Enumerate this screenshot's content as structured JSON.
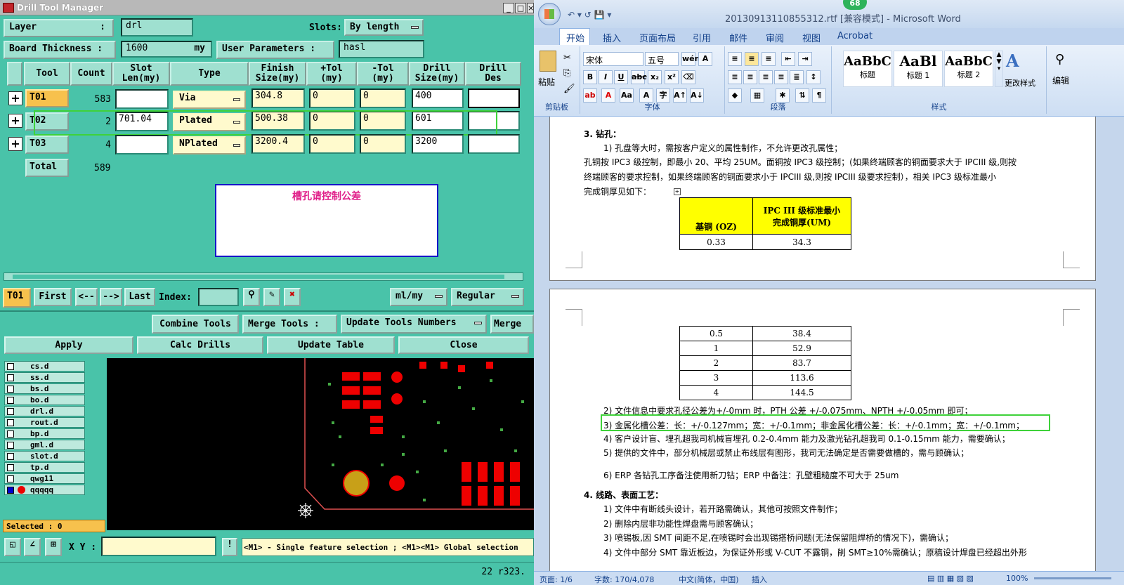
{
  "drill_tool_manager": {
    "title": "Drill Tool Manager",
    "window_buttons": [
      "_",
      "□",
      "×"
    ],
    "layer_label": "Layer",
    "layer_colon": ":",
    "layer_value": "drl",
    "slots_label": "Slots:",
    "slots_value": "By length",
    "board_thickness_label": "Board Thickness :",
    "board_thickness_value": "1600",
    "board_thickness_unit": "my",
    "user_params_label": "User Parameters :",
    "user_params_value": "hasl",
    "columns": [
      "Tool",
      "Count",
      "Slot\nLen(my)",
      "Type",
      "Finish\nSize(my)",
      "+Tol\n(my)",
      "-Tol\n(my)",
      "Drill\nSize(my)",
      "Drill\nDes"
    ],
    "rows": [
      {
        "tool": "T01",
        "count": "583",
        "slot_len": "",
        "type": "Via",
        "finish": "304.8",
        "ptol": "0",
        "ntol": "0",
        "drill": "400",
        "des": ""
      },
      {
        "tool": "T02",
        "count": "2",
        "slot_len": "701.04",
        "type": "Plated",
        "finish": "500.38",
        "ptol": "0",
        "ntol": "0",
        "drill": "601",
        "des": ""
      },
      {
        "tool": "T03",
        "count": "4",
        "slot_len": "",
        "type": "NPlated",
        "finish": "3200.4",
        "ptol": "0",
        "ntol": "0",
        "drill": "3200",
        "des": ""
      }
    ],
    "total_label": "Total",
    "total_count": "589",
    "note": "槽孔请控制公差",
    "nav": {
      "current": "T01",
      "first": "First",
      "prev": "<--",
      "next": "-->",
      "last": "Last",
      "index_label": "Index:",
      "units": "ml/my",
      "mode": "Regular"
    },
    "tool_buttons": [
      "Combine Tools",
      "Merge Tools :",
      "Update Tools Numbers",
      "Merge"
    ],
    "action_buttons": [
      "Apply",
      "Calc Drills",
      "Update Table",
      "Close"
    ],
    "layers": [
      "cs.d",
      "ss.d",
      "bs.d",
      "bo.d",
      "drl.d",
      "rout.d",
      "bp.d",
      "gml.d",
      "slot.d",
      "tp.d",
      "qwg11",
      "qqqqq"
    ],
    "selected": "Selected : 0",
    "xy_label": "X Y :",
    "hint": "<M1> - Single feature selection ; <M1><M1> Global selection",
    "corner": "22 r323."
  },
  "word": {
    "title": "20130913110855312.rtf [兼容模式] - Microsoft Word",
    "badge": "68",
    "tabs": [
      "开始",
      "插入",
      "页面布局",
      "引用",
      "邮件",
      "审阅",
      "视图",
      "Acrobat"
    ],
    "clipboard": {
      "paste": "粘贴",
      "group": "剪贴板"
    },
    "font": {
      "name": "宋体",
      "size": "五号",
      "group": "字体"
    },
    "paragraph_group": "段落",
    "styles": [
      {
        "sample": "AaBbC",
        "name": "标题"
      },
      {
        "sample": "AaBl",
        "name": "标题 1"
      },
      {
        "sample": "AaBbC",
        "name": "标题 2"
      }
    ],
    "change_styles": "更改样式",
    "styles_group": "样式",
    "edit": "编辑",
    "page1": {
      "heading": "3.  钻孔：",
      "p1": "1)  孔盘等大时，需按客户定义的属性制作，不允许更改孔属性；",
      "p2": "孔铜按 IPC3 级控制，即最小 20、平均 25UM。面铜按 IPC3 级控制；(如果终端顾客的铜面要求大于 IPCIII 级,则按",
      "p3": "终端顾客的要求控制，如果终端顾客的铜面要求小于 IPCIII 级,则按 IPCIII 级要求控制），相关 IPC3 级标准最小",
      "p4": "完成铜厚见如下：",
      "table_head": [
        "基铜 (OZ)",
        "IPC III 级标准最小\n完成铜厚(UM)"
      ],
      "table_row": [
        "0.33",
        "34.3"
      ]
    },
    "page2": {
      "table_rows": [
        [
          "0.5",
          "38.4"
        ],
        [
          "1",
          "52.9"
        ],
        [
          "2",
          "83.7"
        ],
        [
          "3",
          "113.6"
        ],
        [
          "4",
          "144.5"
        ]
      ],
      "items": [
        "2)  文件信息中要求孔径公差为+/-0mm 时，PTH 公差 +/-0.075mm、NPTH +/-0.05mm 即可；",
        "3)  金属化槽公差：长：+/-0.127mm；宽：+/-0.1mm；非金属化槽公差：长：+/-0.1mm；宽：+/-0.1mm；",
        "4)  客户设计盲、埋孔超我司机械盲埋孔 0.2-0.4mm 能力及激光钻孔超我司 0.1-0.15mm 能力，需要确认；",
        "5)  提供的文件中，部分机械层或禁止布线层有图形，我司无法确定是否需要做槽的，需与顾确认；",
        "6)  ERP 各钻孔工序备注使用新刀钻；ERP 中备注：孔壁粗糙度不可大于 25um"
      ],
      "heading4": "4.  线路、表面工艺：",
      "items4": [
        "1)  文件中有断线头设计，若开路需确认，其他可按照文件制作；",
        "2)  删除内层非功能性焊盘需与顾客确认；",
        "3)  喷锡板,因 SMT 间距不足,在喷锡时会出现锡搭桥问题(无法保留阻焊桥的情况下)，需确认；",
        "4)  文件中部分 SMT 靠近板边，为保证外形或 V-CUT 不露铜，削 SMT≥10%需确认；原稿设计焊盘已经超出外形"
      ]
    },
    "status": {
      "page": "页面: 1/6",
      "words": "字数: 170/4,078",
      "lang": "中文(简体，中国)",
      "mode": "插入",
      "zoom": "100%"
    }
  }
}
